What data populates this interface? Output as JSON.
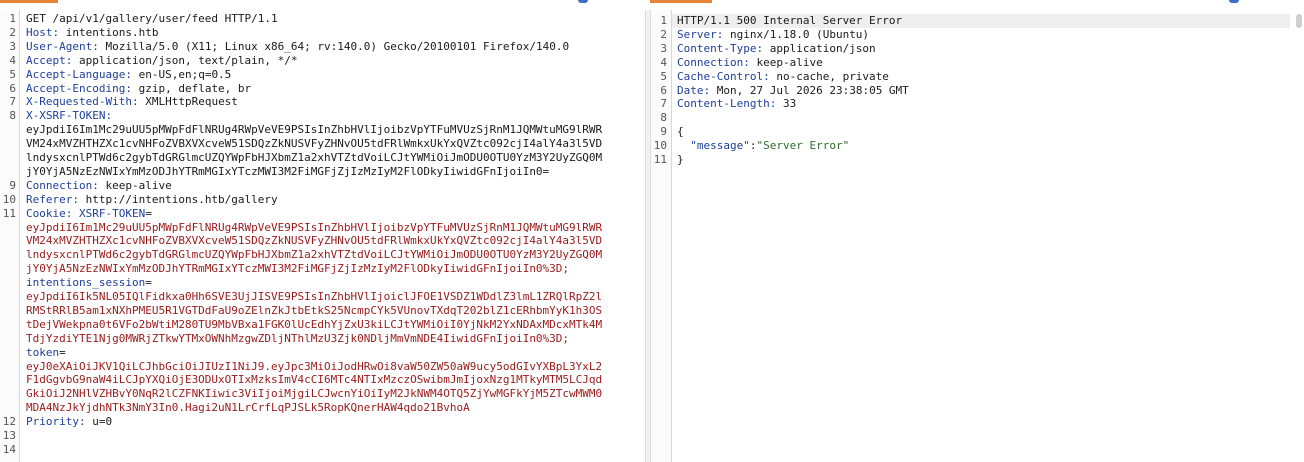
{
  "request": {
    "lines": [
      {
        "n": "1",
        "parts": [
          {
            "t": "GET /api/v1/gallery/user/feed HTTP/1.1",
            "c": "v"
          }
        ]
      },
      {
        "n": "2",
        "parts": [
          {
            "t": "Host:",
            "c": "k"
          },
          {
            "t": " intentions.htb",
            "c": "v"
          }
        ]
      },
      {
        "n": "3",
        "parts": [
          {
            "t": "User-Agent:",
            "c": "k"
          },
          {
            "t": " Mozilla/5.0 (X11; Linux x86_64; rv:140.0) Gecko/20100101 Firefox/140.0",
            "c": "v"
          }
        ]
      },
      {
        "n": "4",
        "parts": [
          {
            "t": "Accept:",
            "c": "k"
          },
          {
            "t": " application/json, text/plain, */*",
            "c": "v"
          }
        ]
      },
      {
        "n": "5",
        "parts": [
          {
            "t": "Accept-Language:",
            "c": "k"
          },
          {
            "t": " en-US,en;q=0.5",
            "c": "v"
          }
        ]
      },
      {
        "n": "6",
        "parts": [
          {
            "t": "Accept-Encoding:",
            "c": "k"
          },
          {
            "t": " gzip, deflate, br",
            "c": "v"
          }
        ]
      },
      {
        "n": "7",
        "parts": [
          {
            "t": "X-Requested-With:",
            "c": "k"
          },
          {
            "t": " XMLHttpRequest",
            "c": "v"
          }
        ]
      },
      {
        "n": "8",
        "parts": [
          {
            "t": "X-XSRF-TOKEN:",
            "c": "k"
          }
        ]
      },
      {
        "n": "",
        "parts": [
          {
            "t": "eyJpdiI6Im1Mc29uUU5pMWpFdFlNRUg4RWpVeVE9PSIsInZhbHVlIjoibzVpYTFuMVUzSjRnM1JQMWtuMG9lRWR",
            "c": "v"
          }
        ]
      },
      {
        "n": "",
        "parts": [
          {
            "t": "VM24xMVZHTHZXc1cvNHFoZVBXVXcveW51SDQzZkNUSVFyZHNvOU5tdFRlWmkxUkYxQVZtc092cjI4alY4a3l5VD",
            "c": "v"
          }
        ]
      },
      {
        "n": "",
        "parts": [
          {
            "t": "lndysxcnlPTWd6c2gybTdGRGlmcUZQYWpFbHJXbmZ1a2xhVTZtdVoiLCJtYWMiOiJmODU0OTU0YzM3Y2UyZGQ0M",
            "c": "v"
          }
        ]
      },
      {
        "n": "",
        "parts": [
          {
            "t": "jY0YjA5NzEzNWIxYmMzODJhYTRmMGIxYTczMWI3M2FiMGFjZjIzMzIyM2FlODkyIiwidGFnIjoiIn0=",
            "c": "v"
          }
        ]
      },
      {
        "n": "9",
        "parts": [
          {
            "t": "Connection:",
            "c": "k"
          },
          {
            "t": " keep-alive",
            "c": "v"
          }
        ]
      },
      {
        "n": "10",
        "parts": [
          {
            "t": "Referer:",
            "c": "k"
          },
          {
            "t": " http://intentions.htb/gallery",
            "c": "v"
          }
        ]
      },
      {
        "n": "11",
        "parts": [
          {
            "t": "Cookie:",
            "c": "k"
          },
          {
            "t": " ",
            "c": "v"
          },
          {
            "t": "XSRF-TOKEN",
            "c": "k"
          },
          {
            "t": "=",
            "c": "v"
          }
        ]
      },
      {
        "n": "",
        "parts": [
          {
            "t": "eyJpdiI6Im1Mc29uUU5pMWpFdFlNRUg4RWpVeVE9PSIsInZhbHVlIjoibzVpYTFuMVUzSjRnM1JQMWtuMG9lRWR",
            "c": "red"
          }
        ]
      },
      {
        "n": "",
        "parts": [
          {
            "t": "VM24xMVZHTHZXc1cvNHFoZVBXVXcveW51SDQzZkNUSVFyZHNvOU5tdFRlWmkxUkYxQVZtc092cjI4alY4a3l5VD",
            "c": "red"
          }
        ]
      },
      {
        "n": "",
        "parts": [
          {
            "t": "lndysxcnlPTWd6c2gybTdGRGlmcUZQYWpFbHJXbmZ1a2xhVTZtdVoiLCJtYWMiOiJmODU0OTU0YzM3Y2UyZGQ0M",
            "c": "red"
          }
        ]
      },
      {
        "n": "",
        "parts": [
          {
            "t": "jY0YjA5NzEzNWIxYmMzODJhYTRmMGIxYTczMWI3M2FiMGFjZjIzMzIyM2FlODkyIiwidGFnIjoiIn0%3D;",
            "c": "red"
          }
        ]
      },
      {
        "n": "",
        "parts": [
          {
            "t": "intentions_session",
            "c": "k"
          },
          {
            "t": "=",
            "c": "v"
          }
        ]
      },
      {
        "n": "",
        "parts": [
          {
            "t": "eyJpdiI6Ik5NL05IQlFidkxa0Hh6SVE3UjJISVE9PSIsInZhbHVlIjoiclJFOE1VSDZ1WDdlZ3lmL1ZRQlRpZ2l",
            "c": "red"
          }
        ]
      },
      {
        "n": "",
        "parts": [
          {
            "t": "RMStRRlB5am1xNXhPMEU5R1VGTDdFaU9oZElnZkJtbEtkS25NcmpCYk5VUnovTXdqT202blZ1cERhbmYyK1h3OS",
            "c": "red"
          }
        ]
      },
      {
        "n": "",
        "parts": [
          {
            "t": "tDejVWekpna0t6VFo2bWtiM280TU9MbVBxa1FGK0lUcEdhYjZxU3kiLCJtYWMiOiI0YjNkM2YxNDAxMDcxMTk4M",
            "c": "red"
          }
        ]
      },
      {
        "n": "",
        "parts": [
          {
            "t": "TdjYzdiYTE1Njg0MWRjZTkwYTMxOWNhMzgwZDljNThlMzU3Zjk0NDljMmVmNDE4IiwidGFnIjoiIn0%3D;",
            "c": "red"
          }
        ]
      },
      {
        "n": "",
        "parts": [
          {
            "t": "token",
            "c": "k"
          },
          {
            "t": "=",
            "c": "v"
          }
        ]
      },
      {
        "n": "",
        "parts": [
          {
            "t": "eyJ0eXAiOiJKV1QiLCJhbGciOiJIUzI1NiJ9.eyJpc3MiOiJodHRwOi8vaW50ZW50aW9ucy5odGIvYXBpL3YxL2",
            "c": "red"
          }
        ]
      },
      {
        "n": "",
        "parts": [
          {
            "t": "F1dGgvbG9naW4iLCJpYXQiOjE3ODUxOTIxMzksImV4cCI6MTc4NTIxMzczOSwibmJmIjoxNzg1MTkyMTM5LCJqd",
            "c": "red"
          }
        ]
      },
      {
        "n": "",
        "parts": [
          {
            "t": "GkiOiJ2NHlVZHBvY0NqR2lCZFNKIiwic3ViIjoiMjgiLCJwcnYiOiIyM2JkNWM4OTQ5ZjYwMGFkYjM5ZTcwMWM0",
            "c": "red"
          }
        ]
      },
      {
        "n": "",
        "parts": [
          {
            "t": "MDA4NzJkYjdhNTk3NmY3In0.Hagi2uN1LrCrfLqPJSLk5RopKQnerHAW4qdo21BvhoA",
            "c": "red"
          }
        ]
      },
      {
        "n": "12",
        "parts": [
          {
            "t": "Priority:",
            "c": "k"
          },
          {
            "t": " u=0",
            "c": "v"
          }
        ]
      },
      {
        "n": "13",
        "parts": []
      },
      {
        "n": "14",
        "parts": []
      }
    ]
  },
  "response": {
    "lines": [
      {
        "n": "1",
        "parts": [
          {
            "t": "HTTP/1.1 500 Internal Server Error",
            "c": "v"
          }
        ],
        "hl": true
      },
      {
        "n": "2",
        "parts": [
          {
            "t": "Server:",
            "c": "k"
          },
          {
            "t": " nginx/1.18.0 (Ubuntu)",
            "c": "v"
          }
        ]
      },
      {
        "n": "3",
        "parts": [
          {
            "t": "Content-Type:",
            "c": "k"
          },
          {
            "t": " application/json",
            "c": "v"
          }
        ]
      },
      {
        "n": "4",
        "parts": [
          {
            "t": "Connection:",
            "c": "k"
          },
          {
            "t": " keep-alive",
            "c": "v"
          }
        ]
      },
      {
        "n": "5",
        "parts": [
          {
            "t": "Cache-Control:",
            "c": "k"
          },
          {
            "t": " no-cache, private",
            "c": "v"
          }
        ]
      },
      {
        "n": "6",
        "parts": [
          {
            "t": "Date:",
            "c": "k"
          },
          {
            "t": " Mon, 27 Jul 2026 23:38:05 GMT",
            "c": "v"
          }
        ]
      },
      {
        "n": "7",
        "parts": [
          {
            "t": "Content-Length:",
            "c": "k"
          },
          {
            "t": " 33",
            "c": "v"
          }
        ]
      },
      {
        "n": "8",
        "parts": []
      },
      {
        "n": "9",
        "parts": [
          {
            "t": "{",
            "c": "v"
          }
        ]
      },
      {
        "n": "10",
        "parts": [
          {
            "t": "  ",
            "c": "v"
          },
          {
            "t": "\"message\"",
            "c": "k"
          },
          {
            "t": ":",
            "c": "v"
          },
          {
            "t": "\"Server Error\"",
            "c": "str"
          }
        ]
      },
      {
        "n": "11",
        "parts": [
          {
            "t": "}",
            "c": "v"
          }
        ]
      }
    ]
  }
}
